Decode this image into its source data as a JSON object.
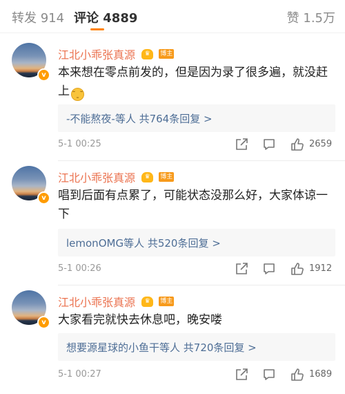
{
  "tabs": {
    "repost": "转发 914",
    "comment": "评论 4889",
    "like": "赞 1.5万",
    "accent_color": "#ff8200"
  },
  "comments": [
    {
      "username": "江北小乖张真源",
      "badge": "博主",
      "text": "本来想在零点前发的，但是因为录了很多遍，就没赶上",
      "emoji": "crying-face",
      "reply_summary": "-不能熬夜-等人  共764条回复 >",
      "time": "5-1 00:25",
      "likes": "2659"
    },
    {
      "username": "江北小乖张真源",
      "badge": "博主",
      "text": "唱到后面有点累了，可能状态没那么好，大家体谅一下",
      "reply_summary": "lemonOMG等人  共520条回复 >",
      "time": "5-1 00:26",
      "likes": "1912"
    },
    {
      "username": "江北小乖张真源",
      "badge": "博主",
      "text": "大家看完就快去休息吧，晚安喽",
      "reply_summary": "想要源星球的小鱼干等人  共720条回复 >",
      "time": "5-1 00:27",
      "likes": "1689"
    }
  ],
  "icons": {
    "share": "share-icon",
    "comment": "comment-icon",
    "like": "thumbs-up-icon",
    "verified": "verified-v-icon",
    "member": "member-crown-icon"
  },
  "colors": {
    "username": "#eb7350",
    "reply_link": "#4e6e96",
    "verified": "#ff9c00"
  }
}
